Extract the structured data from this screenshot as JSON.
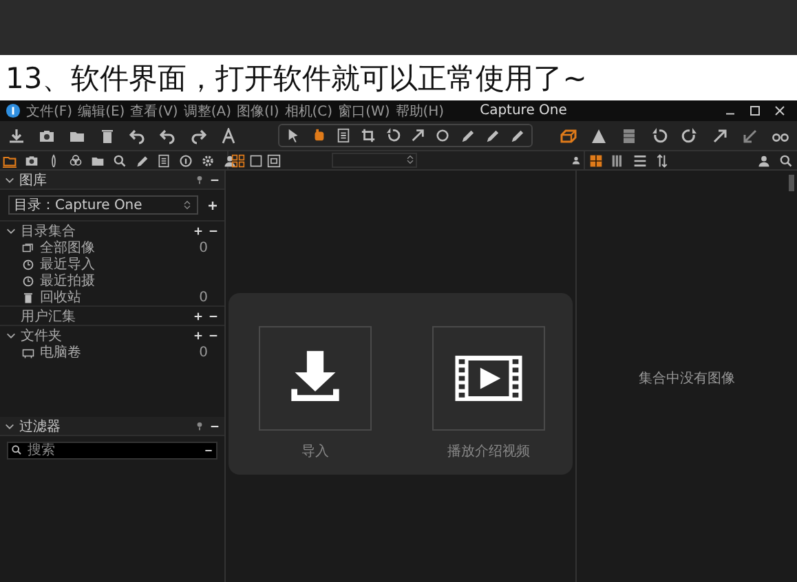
{
  "article": {
    "heading": "13、软件界面，打开软件就可以正常使用了~"
  },
  "window": {
    "title": "Capture One",
    "menu": [
      "文件(F)",
      "编辑(E)",
      "查看(V)",
      "调整(A)",
      "图像(I)",
      "相机(C)",
      "窗口(W)",
      "帮助(H)"
    ]
  },
  "library": {
    "title": "图库",
    "catalog": "目录：Capture One",
    "sections": [
      {
        "title": "目录集合",
        "collapsible": true,
        "items": [
          {
            "label": "全部图像",
            "count": "0"
          },
          {
            "label": "最近导入"
          },
          {
            "label": "最近拍摄"
          },
          {
            "label": "回收站",
            "count": "0"
          }
        ]
      },
      {
        "title": "用户汇集",
        "collapsible": false
      },
      {
        "title": "文件夹",
        "collapsible": true,
        "items": [
          {
            "label": "电脑卷",
            "count": "0"
          }
        ]
      }
    ]
  },
  "filter": {
    "title": "过滤器",
    "search": {
      "placeholder": "搜索"
    }
  },
  "viewer": {
    "actions": [
      {
        "kind": "import",
        "label": "导入"
      },
      {
        "kind": "video",
        "label": "播放介绍视频"
      }
    ]
  },
  "browser": {
    "empty_message": "集合中没有图像"
  }
}
